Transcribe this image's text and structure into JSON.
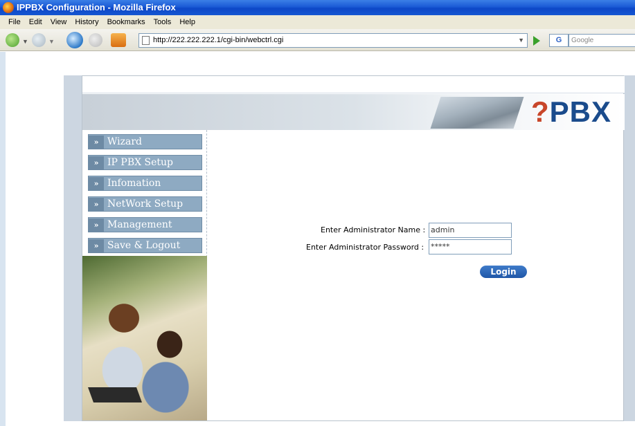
{
  "window": {
    "title": "IPPBX Configuration - Mozilla Firefox"
  },
  "menubar": [
    "File",
    "Edit",
    "View",
    "History",
    "Bookmarks",
    "Tools",
    "Help"
  ],
  "toolbar": {
    "url": "http://222.222.222.1/cgi-bin/webctrl.cgi",
    "search_engine": "G",
    "search_placeholder": "Google"
  },
  "brand": {
    "logo_prefix": "?",
    "logo_text": "PBX"
  },
  "nav": {
    "arrow": "»",
    "items": [
      "Wizard",
      "IP PBX Setup",
      "Infomation",
      "NetWork Setup",
      "Management",
      "Save & Logout"
    ]
  },
  "login": {
    "name_label": "Enter Administrator Name :",
    "name_value": "admin",
    "password_label": "Enter Administrator Password :",
    "password_value": "*****",
    "button_label": "Login"
  },
  "colors": {
    "menu_bg": "#8eaac2",
    "button_bg": "#2a64b4",
    "logo": "#1a4b8c"
  }
}
